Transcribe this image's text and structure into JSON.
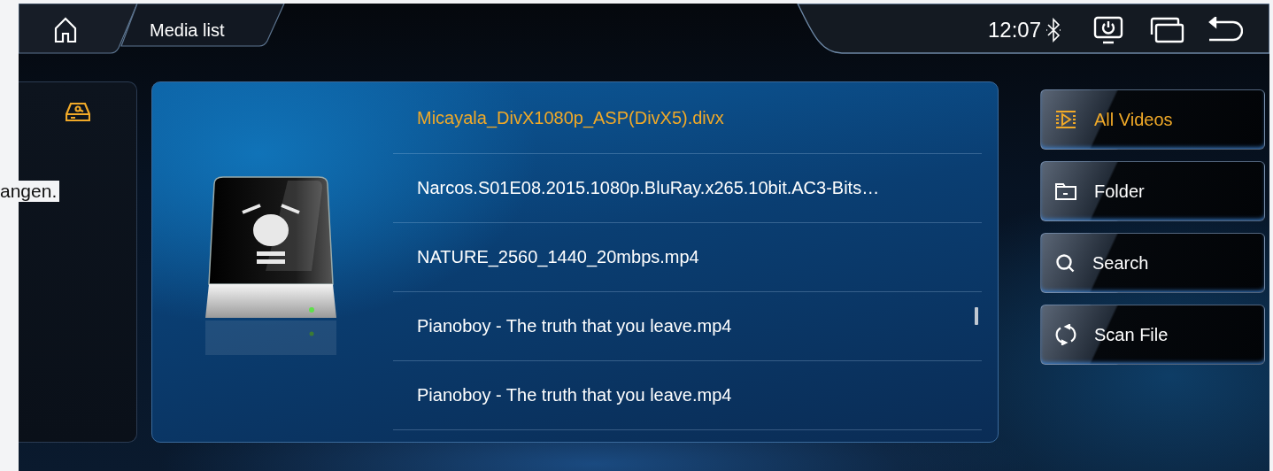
{
  "page_fragment": {
    "text": "angen."
  },
  "top_bar": {
    "title": "Media list",
    "time": "12:07"
  },
  "sources": [
    {
      "kind": "usb_drive",
      "selected": true
    }
  ],
  "files": [
    {
      "name": "Micayala_DivX1080p_ASP(DivX5).divx",
      "selected": true
    },
    {
      "name": "Narcos.S01E08.2015.1080p.BluRay.x265.10bit.AC3-Bits…",
      "selected": false
    },
    {
      "name": "NATURE_2560_1440_20mbps.mp4",
      "selected": false
    },
    {
      "name": "Pianoboy - The truth that you leave.mp4",
      "selected": false
    },
    {
      "name": "Pianoboy - The truth that you leave.mp4",
      "selected": false
    }
  ],
  "actions": [
    {
      "label": "All Videos",
      "kind": "videos",
      "selected": true
    },
    {
      "label": "Folder",
      "kind": "folder",
      "selected": false
    },
    {
      "label": "Search",
      "kind": "search",
      "selected": false
    },
    {
      "label": "Scan File",
      "kind": "scan",
      "selected": false
    }
  ]
}
